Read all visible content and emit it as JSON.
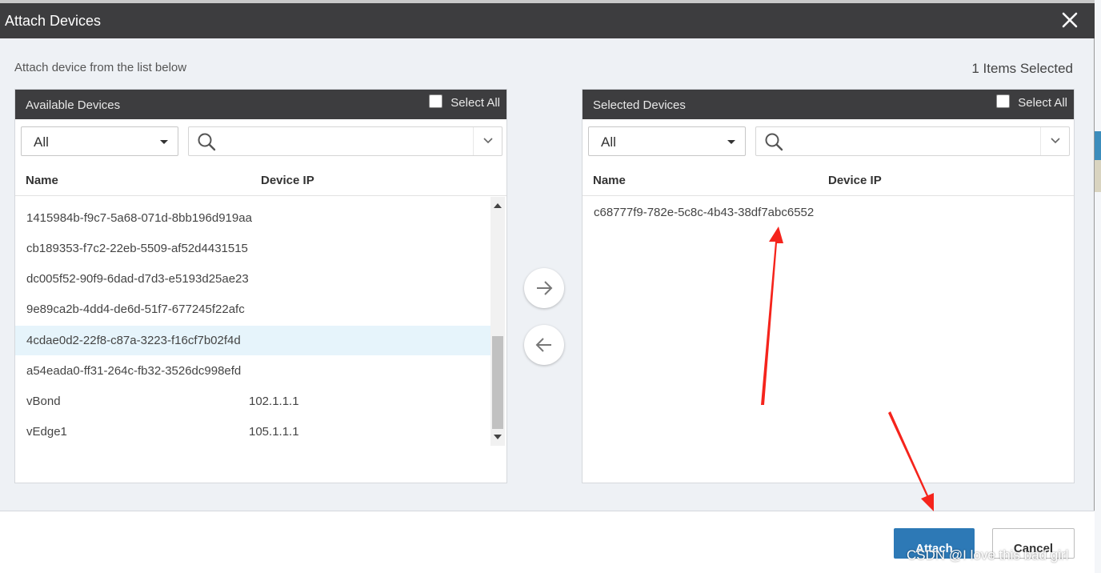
{
  "dialog": {
    "title": "Attach Devices",
    "hint": "Attach device from the list below",
    "selected_count": "1 Items Selected"
  },
  "available": {
    "title": "Available Devices",
    "select_all": "Select All",
    "filter_value": "All",
    "search_placeholder": "",
    "col_name": "Name",
    "col_ip": "Device IP",
    "rows": [
      {
        "name": "1415984b-f9c7-5a68-071d-8bb196d919aa",
        "ip": ""
      },
      {
        "name": "cb189353-f7c2-22eb-5509-af52d4431515",
        "ip": ""
      },
      {
        "name": "dc005f52-90f9-6dad-d7d3-e5193d25ae23",
        "ip": ""
      },
      {
        "name": "9e89ca2b-4dd4-de6d-51f7-677245f22afc",
        "ip": ""
      },
      {
        "name": "4cdae0d2-22f8-c87a-3223-f16cf7b02f4d",
        "ip": ""
      },
      {
        "name": "a54eada0-ff31-264c-fb32-3526dc998efd",
        "ip": ""
      },
      {
        "name": "vBond",
        "ip": "102.1.1.1"
      },
      {
        "name": "vEdge1",
        "ip": "105.1.1.1"
      }
    ],
    "highlighted_row": 4
  },
  "selected": {
    "title": "Selected Devices",
    "select_all": "Select All",
    "filter_value": "All",
    "search_placeholder": "",
    "col_name": "Name",
    "col_ip": "Device IP",
    "rows": [
      {
        "name": "c68777f9-782e-5c8c-4b43-38df7abc6552",
        "ip": ""
      }
    ]
  },
  "footer": {
    "attach_label": "Attach",
    "cancel_label": "Cancel"
  },
  "watermark": "CSDN @I love this bad girl",
  "icons": {
    "close": "close-icon",
    "search": "search-icon",
    "chevron": "chevron-down-icon",
    "move_right": "arrow-right-icon",
    "move_left": "arrow-left-icon"
  },
  "colors": {
    "header_bg": "#3d3d3f",
    "dialog_bg": "#eef1f5",
    "accent": "#2d79b6",
    "row_highlight": "#e6f4fb",
    "annotation_arrow": "#f5241c"
  }
}
